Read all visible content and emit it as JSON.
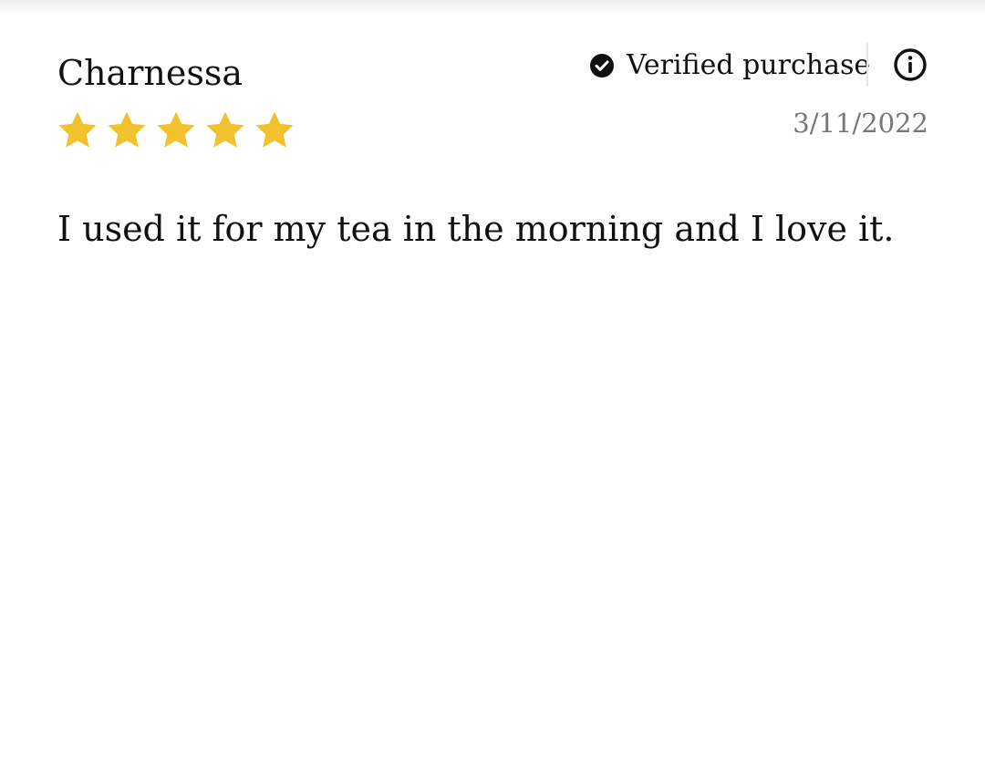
{
  "review": {
    "reviewer_name": "Charnessa",
    "rating": 5,
    "rating_max": 5,
    "star_icon": "star-icon",
    "star_color": "#F2C12E",
    "verified": {
      "icon": "check-circle-icon",
      "label": "Verified purchase"
    },
    "info_icon": "info-icon",
    "date": "3/11/2022",
    "body": "I used it for my tea in the morning and I love it."
  }
}
